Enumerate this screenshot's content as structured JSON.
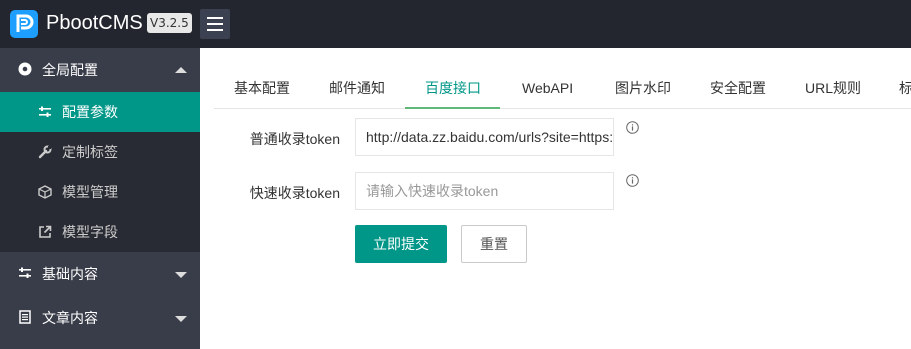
{
  "header": {
    "brand": "PbootCMS",
    "version": "V3.2.5"
  },
  "sidebar": {
    "groups": [
      {
        "label": "全局配置",
        "icon": "gear-circle-icon",
        "expanded": true,
        "items": [
          {
            "label": "配置参数",
            "icon": "sliders-icon",
            "active": true
          },
          {
            "label": "定制标签",
            "icon": "wrench-icon"
          },
          {
            "label": "模型管理",
            "icon": "cube-icon"
          },
          {
            "label": "模型字段",
            "icon": "external-link-icon"
          }
        ]
      },
      {
        "label": "基础内容",
        "icon": "sliders-icon",
        "expanded": false
      },
      {
        "label": "文章内容",
        "icon": "document-icon",
        "expanded": false
      }
    ]
  },
  "tabs": [
    "基本配置",
    "邮件通知",
    "百度接口",
    "WebAPI",
    "图片水印",
    "安全配置",
    "URL规则",
    "标"
  ],
  "active_tab": "百度接口",
  "form": {
    "fields": [
      {
        "label": "普通收录token",
        "value": "http://data.zz.baidu.com/urls?site=https://",
        "placeholder": ""
      },
      {
        "label": "快速收录token",
        "value": "",
        "placeholder": "请输入快速收录token"
      }
    ],
    "submit_label": "立即提交",
    "reset_label": "重置"
  },
  "colors": {
    "header_bg": "#23262e",
    "sidebar_bg": "#393d49",
    "sidebar_sub_bg": "#282b33",
    "accent": "#009688"
  }
}
